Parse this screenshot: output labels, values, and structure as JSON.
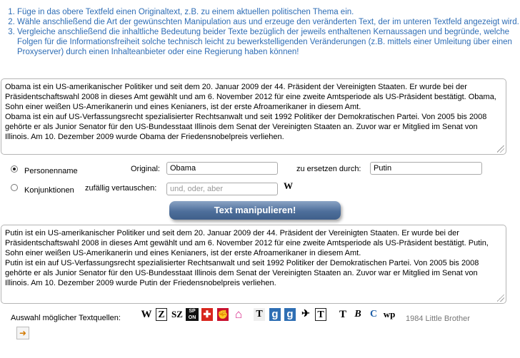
{
  "instructions": [
    "Füge in das obere Textfeld einen Originaltext, z.B. zu einem aktuellen politischen Thema ein.",
    "Wähle anschließend die Art der gewünschten Manipulation aus und erzeuge den veränderten Text, der im unteren Textfeld angezeigt wird.",
    "Vergleiche anschließend die inhaltliche Bedeutung beider Texte bezüglich der jeweils enthaltenen Kernaussagen und begründe, welche Folgen für die Informationsfreiheit solche technisch leicht zu bewerkstelligenden Veränderungen (z.B. mittels einer Umleitung über einen Proxyserver) durch einen Inhalteanbieter oder eine Regierung haben können!"
  ],
  "original_text": [
    "Obama ist ein US-amerikanischer Politiker und seit dem 20. Januar 2009 der 44. Präsident der Vereinigten Staaten. Er wurde bei der Präsidentschaftswahl 2008 in dieses Amt gewählt und am 6. November 2012 für eine zweite Amtsperiode als US-Präsident bestätigt. Obama, Sohn einer weißen US-Amerikanerin und eines Kenianers, ist der erste Afroamerikaner in diesem Amt.",
    "Obama ist ein auf US-Verfassungsrecht spezialisierter Rechtsanwalt und seit 1992 Politiker der Demokratischen Partei. Von 2005 bis 2008 gehörte er als Junior Senator für den US-Bundesstaat Illinois dem Senat der Vereinigten Staaten an. Zuvor war er Mitglied im Senat von Illinois. Am 10. Dezember 2009 wurde Obama der Friedensnobelpreis verliehen."
  ],
  "options": {
    "person": {
      "label": "Personenname",
      "selected": true,
      "original_label": "Original:",
      "original_value": "Obama",
      "replace_label": "zu ersetzen durch:",
      "replace_value": "Putin"
    },
    "conjunctions": {
      "label": "Konjunktionen",
      "selected": false,
      "swap_label": "zufällig vertauschen:",
      "swap_placeholder": "und, oder, aber"
    },
    "wiki_icon": "W"
  },
  "action_button": "Text manipulieren!",
  "result_text": [
    "Putin ist ein US-amerikanischer Politiker und seit dem 20. Januar 2009 der 44. Präsident der Vereinigten Staaten. Er wurde bei der Präsidentschaftswahl 2008 in dieses Amt gewählt und am 6. November 2012 für eine zweite Amtsperiode als US-Präsident bestätigt. Putin, Sohn einer weißen US-Amerikanerin und eines Kenianers, ist der erste Afroamerikaner in diesem Amt.",
    "Putin ist ein auf US-Verfassungsrecht spezialisierter Rechtsanwalt und seit 1992 Politiker der Demokratischen Partei. Von 2005 bis 2008 gehörte er als Junior Senator für den US-Bundesstaat Illinois dem Senat der Vereinigten Staaten an. Zuvor war er Mitglied im Senat von Illinois. Am 10. Dezember 2009 wurde Putin der Friedensnobelpreis verliehen."
  ],
  "sources": {
    "label": "Auswahl möglicher Textquellen:",
    "icons": [
      {
        "name": "wikipedia-icon",
        "glyph": "W"
      },
      {
        "name": "zeit-icon",
        "glyph": "Z"
      },
      {
        "name": "sz-icon",
        "glyph": "SZ"
      },
      {
        "name": "spiegel-online-icon",
        "glyph": "SP ON"
      },
      {
        "name": "red-cross-icon",
        "glyph": "✚"
      },
      {
        "name": "red-fist-icon",
        "glyph": "✊"
      },
      {
        "name": "pink-house-icon",
        "glyph": "⌂"
      },
      {
        "name": "times-icon",
        "glyph": "T"
      },
      {
        "name": "google-icon-1",
        "glyph": "g"
      },
      {
        "name": "google-icon-2",
        "glyph": "g"
      },
      {
        "name": "eagle-icon",
        "glyph": "✈"
      },
      {
        "name": "telegraph-icon",
        "glyph": "T"
      },
      {
        "name": "nyt-icon",
        "glyph": "T"
      },
      {
        "name": "b-icon",
        "glyph": "B"
      },
      {
        "name": "c-icon",
        "glyph": "C"
      },
      {
        "name": "wp-icon",
        "glyph": "wp"
      }
    ],
    "extra_text": "1984 Little Brother"
  },
  "colors": {
    "instructions": "#2e6db5",
    "button_top": "#8ba3c4",
    "button_bottom": "#3f5f8a"
  }
}
